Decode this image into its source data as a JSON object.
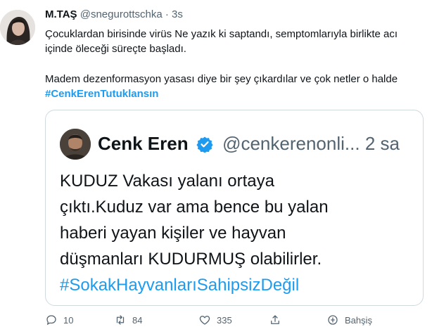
{
  "tweet": {
    "author_name": "M.TAŞ",
    "handle": "@snegurottschka",
    "separator": "·",
    "time": "3s",
    "line1": "Çocuklardan birisinde virüs Ne yazık ki saptandı, semptomlarıyla birlikte acı",
    "line2": "içinde öleceği süreçte başladı.",
    "line3": "Madem dezenformasyon yasası diye bir şey çıkardılar ve çok netler o halde",
    "hashtag": "#CenkErenTutuklansın"
  },
  "quote": {
    "author_name": "Cenk Eren",
    "handle": "@cenkerenonli...",
    "time": "2 sa",
    "line1": "KUDUZ Vakası yalanı ortaya",
    "line2": "çıktı.Kuduz var ama bence bu yalan",
    "line3": "haberi yayan kişiler ve hayvan",
    "line4": "düşmanları KUDURMUŞ olabilirler.",
    "hashtag": "#SokakHayvanlarıSahipsizDeğil"
  },
  "actions": {
    "replies": "10",
    "retweets": "84",
    "likes": "335",
    "tip_label": "Bahşiş"
  },
  "colors": {
    "accent": "#1d9bf0",
    "muted": "#536471",
    "text": "#0f1419",
    "border": "#cfd9de"
  }
}
